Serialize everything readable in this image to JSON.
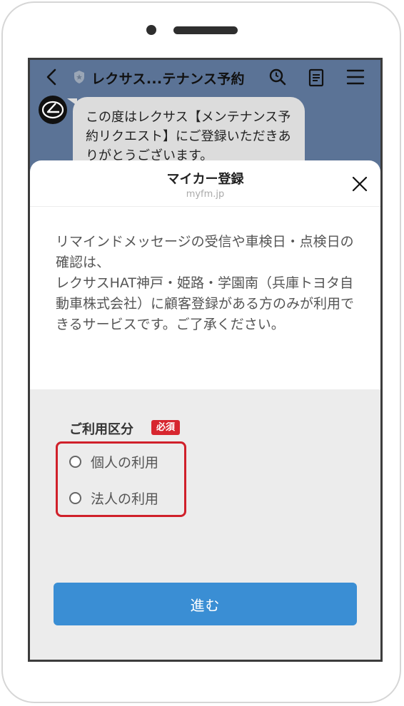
{
  "header": {
    "title": "レクサス...テナンス予約"
  },
  "chat": {
    "message": "この度はレクサス【メンテナンス予約リクエスト】にご登録いただきありがとうございます。"
  },
  "sheet": {
    "title": "マイカー登録",
    "domain": "myfm.jp",
    "notice": "リマインドメッセージの受信や車検日・点検日の確認は、\nレクサスHAT神戸・姫路・学園南（兵庫トヨタ自動車株式会社）に顧客登録がある方のみが利用できるサービスです。ご了承ください。",
    "field_label": "ご利用区分",
    "required_badge": "必須",
    "options": [
      {
        "label": "個人の利用"
      },
      {
        "label": "法人の利用"
      }
    ],
    "next_label": "進む"
  },
  "colors": {
    "header_bg": "#5b7396",
    "required_red": "#d7262f",
    "highlight_red": "#d0202a",
    "button_blue": "#3a8ed4"
  },
  "icons": [
    "back-icon",
    "shield-icon",
    "search-icon",
    "notes-icon",
    "menu-icon",
    "lexus-logo-icon",
    "close-icon",
    "radio-icon"
  ]
}
